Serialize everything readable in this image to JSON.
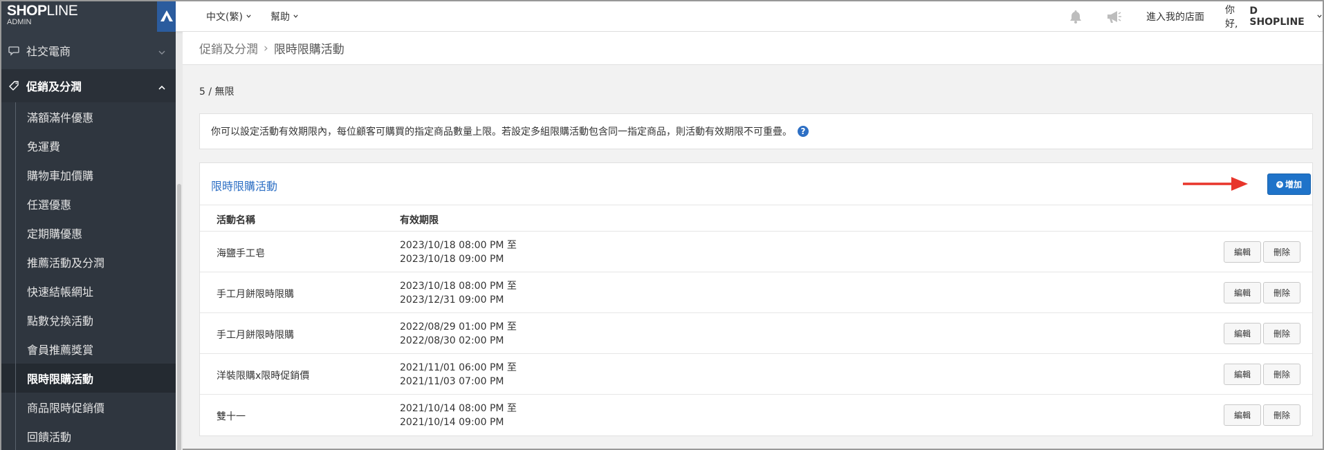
{
  "logo": {
    "brand_bold": "SHOP",
    "brand_light": "LINE",
    "subtitle": "ADMIN"
  },
  "sidebar": {
    "sections": [
      {
        "label": "社交電商",
        "icon": "chat-bubble-icon",
        "expanded": false
      },
      {
        "label": "促銷及分潤",
        "icon": "tag-icon",
        "expanded": true
      }
    ],
    "items": [
      {
        "label": "滿額滿件優惠"
      },
      {
        "label": "免運費"
      },
      {
        "label": "購物車加價購"
      },
      {
        "label": "任選優惠"
      },
      {
        "label": "定期購優惠"
      },
      {
        "label": "推薦活動及分潤"
      },
      {
        "label": "快速結帳網址"
      },
      {
        "label": "點數兌換活動"
      },
      {
        "label": "會員推薦獎賞"
      },
      {
        "label": "限時限購活動",
        "current": true
      },
      {
        "label": "商品限時促銷價"
      },
      {
        "label": "回饋活動"
      }
    ]
  },
  "topbar": {
    "language": "中文(繁)",
    "help": "幫助",
    "store_link": "進入我的店面",
    "greeting_prefix": "你好,",
    "user_name": "D SHOPLINE"
  },
  "breadcrumb": {
    "parent": "促銷及分潤",
    "current": "限時限購活動"
  },
  "quota": "5 / 無限",
  "info": "你可以設定活動有效期限內，每位顧客可購買的指定商品數量上限。若設定多組限購活動包含同一指定商品，則活動有效期限不可重疊。",
  "panel": {
    "title": "限時限購活動",
    "add_label": "增加",
    "columns": [
      "活動名稱",
      "有效期限"
    ],
    "rows": [
      {
        "name": "海鹽手工皂",
        "start": "2023/10/18 08:00 PM 至",
        "end": "2023/10/18 09:00 PM"
      },
      {
        "name": "手工月餅限時限購",
        "start": "2023/10/18 08:00 PM 至",
        "end": "2023/12/31 09:00 PM"
      },
      {
        "name": "手工月餅限時限購",
        "start": "2022/08/29 01:00 PM 至",
        "end": "2022/08/30 02:00 PM"
      },
      {
        "name": "洋裝限購x限時促銷價",
        "start": "2021/11/01 06:00 PM 至",
        "end": "2021/11/03 07:00 PM"
      },
      {
        "name": "雙十一",
        "start": "2021/10/14 08:00 PM 至",
        "end": "2021/10/14 09:00 PM"
      }
    ],
    "edit_label": "編輯",
    "delete_label": "刪除"
  },
  "colors": {
    "sidebar": "#343c46",
    "accent": "#1f73c9",
    "arrow": "#e8352b"
  }
}
